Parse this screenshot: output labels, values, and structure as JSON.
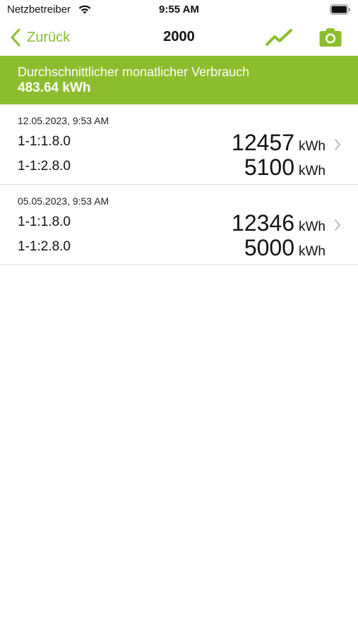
{
  "status_bar": {
    "carrier": "Netzbetreiber",
    "time": "9:55 AM"
  },
  "nav": {
    "back_label": "Zurück",
    "title": "2000",
    "icons": [
      "chart-icon",
      "camera-icon"
    ]
  },
  "banner": {
    "label": "Durchschnittlicher monatlicher Verbrauch",
    "value": "483.64 kWh"
  },
  "readings": [
    {
      "date": "12.05.2023, 9:53 AM",
      "rows": [
        {
          "obis": "1-1:1.8.0",
          "value": "12457",
          "unit": "kWh"
        },
        {
          "obis": "1-1:2.8.0",
          "value": "5100",
          "unit": "kWh"
        }
      ]
    },
    {
      "date": "05.05.2023, 9:53 AM",
      "rows": [
        {
          "obis": "1-1:1.8.0",
          "value": "12346",
          "unit": "kWh"
        },
        {
          "obis": "1-1:2.8.0",
          "value": "5000",
          "unit": "kWh"
        }
      ]
    }
  ],
  "colors": {
    "accent": "#8cbd2e",
    "divider": "#d9d9d9"
  }
}
